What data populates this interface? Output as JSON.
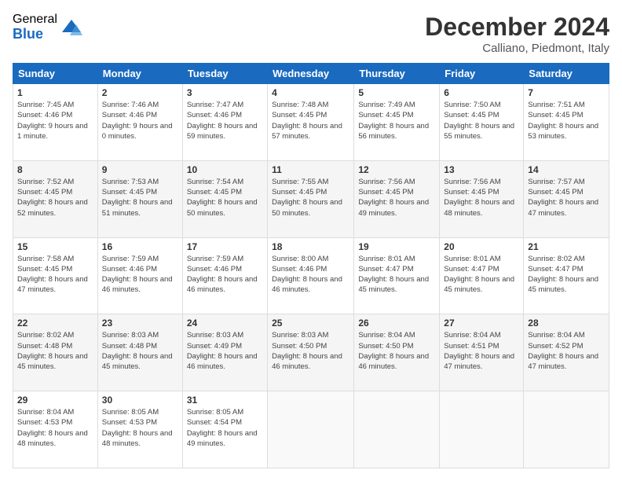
{
  "logo": {
    "general": "General",
    "blue": "Blue"
  },
  "title": "December 2024",
  "location": "Calliano, Piedmont, Italy",
  "headers": [
    "Sunday",
    "Monday",
    "Tuesday",
    "Wednesday",
    "Thursday",
    "Friday",
    "Saturday"
  ],
  "weeks": [
    [
      {
        "day": "1",
        "sunrise": "7:45 AM",
        "sunset": "4:46 PM",
        "daylight": "9 hours and 1 minute."
      },
      {
        "day": "2",
        "sunrise": "7:46 AM",
        "sunset": "4:46 PM",
        "daylight": "9 hours and 0 minutes."
      },
      {
        "day": "3",
        "sunrise": "7:47 AM",
        "sunset": "4:46 PM",
        "daylight": "8 hours and 59 minutes."
      },
      {
        "day": "4",
        "sunrise": "7:48 AM",
        "sunset": "4:45 PM",
        "daylight": "8 hours and 57 minutes."
      },
      {
        "day": "5",
        "sunrise": "7:49 AM",
        "sunset": "4:45 PM",
        "daylight": "8 hours and 56 minutes."
      },
      {
        "day": "6",
        "sunrise": "7:50 AM",
        "sunset": "4:45 PM",
        "daylight": "8 hours and 55 minutes."
      },
      {
        "day": "7",
        "sunrise": "7:51 AM",
        "sunset": "4:45 PM",
        "daylight": "8 hours and 53 minutes."
      }
    ],
    [
      {
        "day": "8",
        "sunrise": "7:52 AM",
        "sunset": "4:45 PM",
        "daylight": "8 hours and 52 minutes."
      },
      {
        "day": "9",
        "sunrise": "7:53 AM",
        "sunset": "4:45 PM",
        "daylight": "8 hours and 51 minutes."
      },
      {
        "day": "10",
        "sunrise": "7:54 AM",
        "sunset": "4:45 PM",
        "daylight": "8 hours and 50 minutes."
      },
      {
        "day": "11",
        "sunrise": "7:55 AM",
        "sunset": "4:45 PM",
        "daylight": "8 hours and 50 minutes."
      },
      {
        "day": "12",
        "sunrise": "7:56 AM",
        "sunset": "4:45 PM",
        "daylight": "8 hours and 49 minutes."
      },
      {
        "day": "13",
        "sunrise": "7:56 AM",
        "sunset": "4:45 PM",
        "daylight": "8 hours and 48 minutes."
      },
      {
        "day": "14",
        "sunrise": "7:57 AM",
        "sunset": "4:45 PM",
        "daylight": "8 hours and 47 minutes."
      }
    ],
    [
      {
        "day": "15",
        "sunrise": "7:58 AM",
        "sunset": "4:45 PM",
        "daylight": "8 hours and 47 minutes."
      },
      {
        "day": "16",
        "sunrise": "7:59 AM",
        "sunset": "4:46 PM",
        "daylight": "8 hours and 46 minutes."
      },
      {
        "day": "17",
        "sunrise": "7:59 AM",
        "sunset": "4:46 PM",
        "daylight": "8 hours and 46 minutes."
      },
      {
        "day": "18",
        "sunrise": "8:00 AM",
        "sunset": "4:46 PM",
        "daylight": "8 hours and 46 minutes."
      },
      {
        "day": "19",
        "sunrise": "8:01 AM",
        "sunset": "4:47 PM",
        "daylight": "8 hours and 45 minutes."
      },
      {
        "day": "20",
        "sunrise": "8:01 AM",
        "sunset": "4:47 PM",
        "daylight": "8 hours and 45 minutes."
      },
      {
        "day": "21",
        "sunrise": "8:02 AM",
        "sunset": "4:47 PM",
        "daylight": "8 hours and 45 minutes."
      }
    ],
    [
      {
        "day": "22",
        "sunrise": "8:02 AM",
        "sunset": "4:48 PM",
        "daylight": "8 hours and 45 minutes."
      },
      {
        "day": "23",
        "sunrise": "8:03 AM",
        "sunset": "4:48 PM",
        "daylight": "8 hours and 45 minutes."
      },
      {
        "day": "24",
        "sunrise": "8:03 AM",
        "sunset": "4:49 PM",
        "daylight": "8 hours and 46 minutes."
      },
      {
        "day": "25",
        "sunrise": "8:03 AM",
        "sunset": "4:50 PM",
        "daylight": "8 hours and 46 minutes."
      },
      {
        "day": "26",
        "sunrise": "8:04 AM",
        "sunset": "4:50 PM",
        "daylight": "8 hours and 46 minutes."
      },
      {
        "day": "27",
        "sunrise": "8:04 AM",
        "sunset": "4:51 PM",
        "daylight": "8 hours and 47 minutes."
      },
      {
        "day": "28",
        "sunrise": "8:04 AM",
        "sunset": "4:52 PM",
        "daylight": "8 hours and 47 minutes."
      }
    ],
    [
      {
        "day": "29",
        "sunrise": "8:04 AM",
        "sunset": "4:53 PM",
        "daylight": "8 hours and 48 minutes."
      },
      {
        "day": "30",
        "sunrise": "8:05 AM",
        "sunset": "4:53 PM",
        "daylight": "8 hours and 48 minutes."
      },
      {
        "day": "31",
        "sunrise": "8:05 AM",
        "sunset": "4:54 PM",
        "daylight": "8 hours and 49 minutes."
      },
      null,
      null,
      null,
      null
    ]
  ]
}
